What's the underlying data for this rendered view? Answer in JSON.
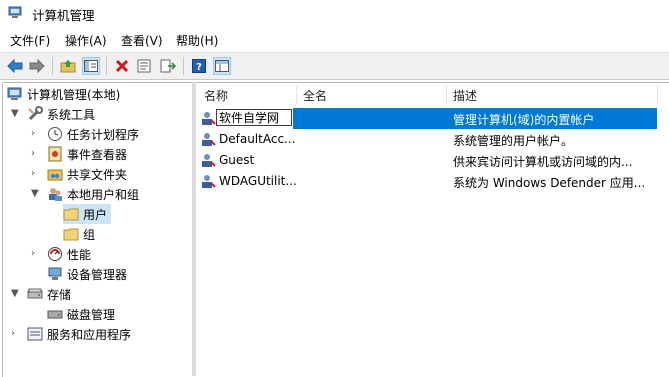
{
  "window": {
    "title": "计算机管理"
  },
  "menu": [
    "文件(F)",
    "操作(A)",
    "查看(V)",
    "帮助(H)"
  ],
  "toolbar": {
    "buttons": [
      "back-icon",
      "forward-icon",
      "up-folder-icon",
      "show-hide-tree-icon",
      "delete-icon",
      "properties-icon",
      "export-list-icon",
      "help-icon",
      "view-pane-icon"
    ]
  },
  "tree": {
    "root": "计算机管理(本地)",
    "system_tools": "系统工具",
    "task_scheduler": "任务计划程序",
    "event_viewer": "事件查看器",
    "shared_folders": "共享文件夹",
    "local_users_groups": "本地用户和组",
    "users": "用户",
    "groups": "组",
    "performance": "性能",
    "device_manager": "设备管理器",
    "storage": "存储",
    "disk_management": "磁盘管理",
    "services_apps": "服务和应用程序"
  },
  "list": {
    "columns": [
      "名称",
      "全名",
      "描述"
    ],
    "rows": [
      {
        "name": "软件自学网",
        "fullname": "",
        "desc": "管理计算机(域)的内置帐户",
        "selected": true,
        "editing": true
      },
      {
        "name": "DefaultAcc...",
        "fullname": "",
        "desc": "系统管理的用户帐户。"
      },
      {
        "name": "Guest",
        "fullname": "",
        "desc": "供来宾访问计算机或访问域的内..."
      },
      {
        "name": "WDAGUtilit...",
        "fullname": "",
        "desc": "系统为 Windows Defender 应用..."
      }
    ]
  },
  "colors": {
    "selection": "#0078d7",
    "tree_selection": "#cce4f7"
  }
}
